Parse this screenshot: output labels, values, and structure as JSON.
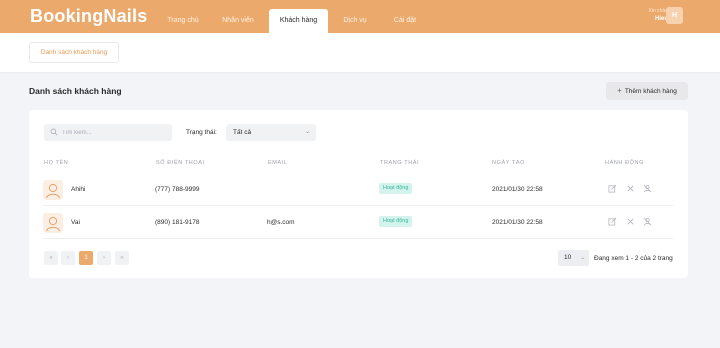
{
  "header": {
    "brand": "BookingNails",
    "nav": [
      {
        "label": "Trang chủ",
        "active": false
      },
      {
        "label": "Nhân viên",
        "active": false
      },
      {
        "label": "Khách hàng",
        "active": true
      },
      {
        "label": "Dịch vụ",
        "active": false
      },
      {
        "label": "Cài đặt",
        "active": false
      }
    ],
    "greeting": "Xin chào",
    "username": "Hieu",
    "avatar_letter": "H",
    "colors": {
      "accent": "#eba96c"
    }
  },
  "subnav": {
    "tab": "Danh sách khách hàng"
  },
  "page": {
    "title": "Danh sách khách hàng",
    "add_button": "Thêm khách hàng"
  },
  "filters": {
    "search_placeholder": "Tìm kiếm...",
    "status_label": "Trạng thái:",
    "status_value": "Tất cả"
  },
  "table": {
    "columns": [
      "HỌ TÊN",
      "SỐ ĐIỆN THOẠI",
      "EMAIL",
      "TRẠNG THÁI",
      "NGÀY TẠO",
      "HÀNH ĐỘNG"
    ],
    "rows": [
      {
        "name": "Ahihi",
        "phone": "(777) 788-9999",
        "email": "",
        "status": "Hoạt động",
        "created": "2021/01/30 22:58"
      },
      {
        "name": "Vai",
        "phone": "(890) 181-9178",
        "email": "h@s.com",
        "status": "Hoạt động",
        "created": "2021/01/30 22:58"
      }
    ],
    "actions": [
      "edit-icon",
      "close-icon",
      "block-user-icon"
    ]
  },
  "pagination": {
    "first": "«",
    "prev": "‹",
    "current": "1",
    "next": "›",
    "last": "»",
    "page_size": "10",
    "info": "Đang xem 1 - 2 của 2 trang"
  }
}
